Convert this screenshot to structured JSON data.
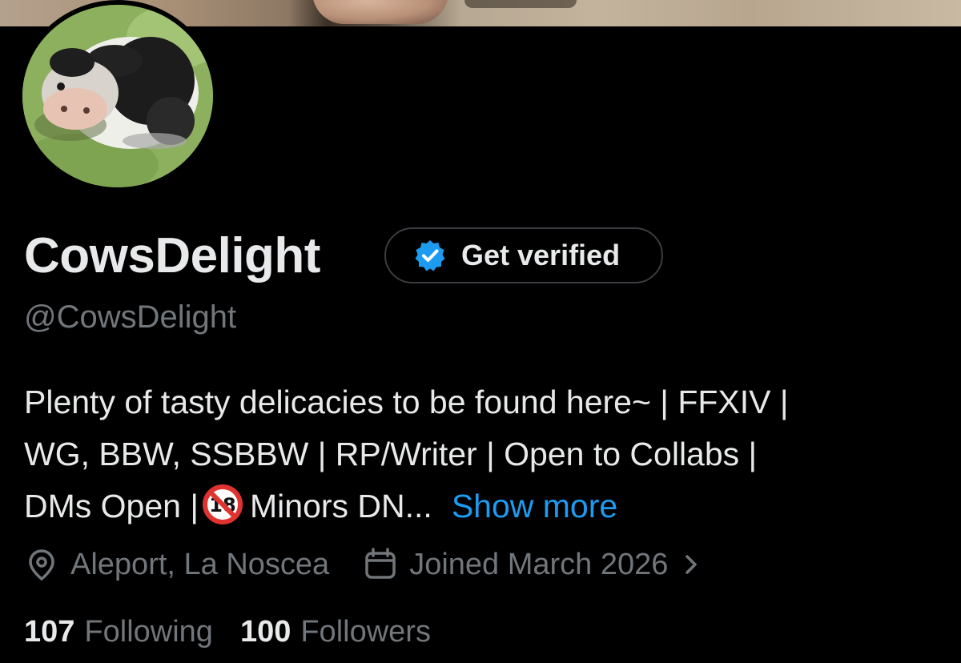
{
  "profile": {
    "display_name": "CowsDelight",
    "handle": "@CowsDelight",
    "verify_button_label": "Get verified",
    "bio_lines": [
      "Plenty of tasty delicacies to be found here~ | FFXIV |",
      "WG, BBW, SSBBW | RP/Writer | Open to Collabs |"
    ],
    "bio_line3_before_icon": "DMs Open |",
    "bio_line3_after_icon": "Minors DN...",
    "show_more_label": "Show more",
    "location": "Aleport, La Noscea",
    "joined": "Joined March 2026",
    "following_count": "107",
    "following_label": "Following",
    "followers_count": "100",
    "followers_label": "Followers"
  },
  "icons": {
    "verify": "verified-badge-icon",
    "no_minors": "no-one-under-eighteen-icon",
    "location": "location-pin-icon",
    "calendar": "calendar-icon",
    "chevron": "chevron-right-icon"
  },
  "colors": {
    "background": "#000000",
    "text_primary": "#e7e9ea",
    "text_secondary": "#71767b",
    "link": "#1d9bf0",
    "badge": "#1d9bf0",
    "button_border": "#3a3d41"
  }
}
